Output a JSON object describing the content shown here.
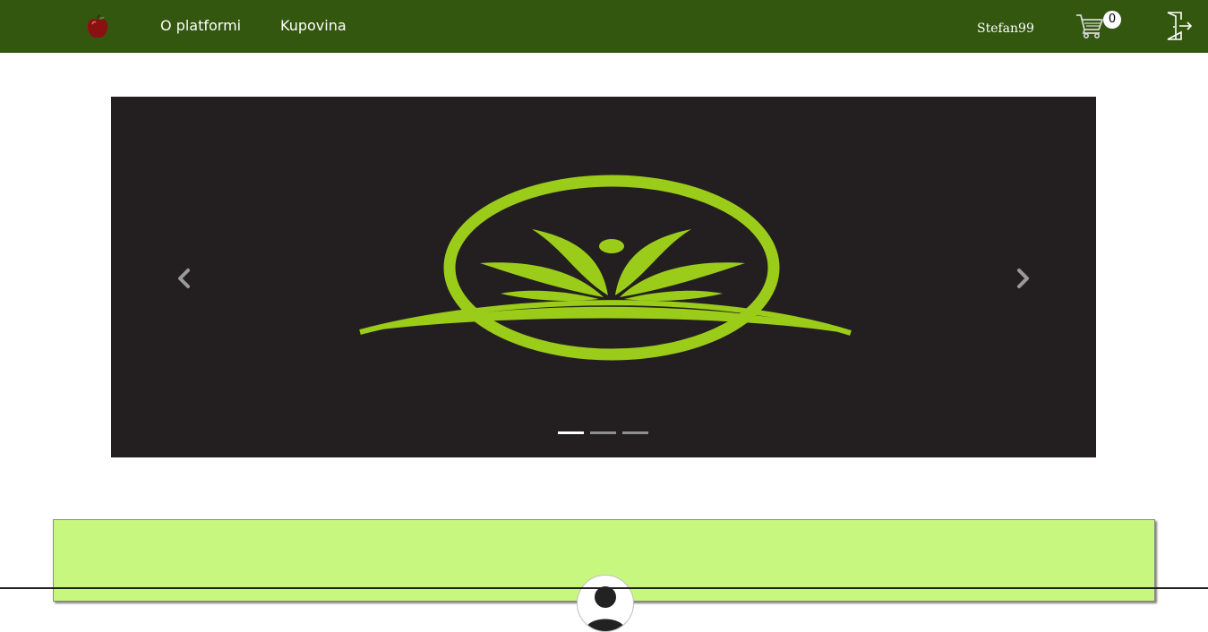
{
  "navbar": {
    "logo_icon": "apple-icon",
    "links": [
      "O platformi",
      "Kupovina"
    ],
    "username": "Stefan99",
    "cart_icon": "cart-icon",
    "cart_count": "0",
    "logout_icon": "logout-door-icon",
    "background": "#33570f"
  },
  "carousel": {
    "slide_icons": [
      "leaf-ring-logo"
    ],
    "prev_icon": "chevron-left-icon",
    "next_icon": "chevron-right-icon",
    "slide_count": 3,
    "active_index": 0,
    "background": "#231f20",
    "accent": "#9ccc1a"
  },
  "panel": {
    "background": "#c7f77f",
    "avatar_icon": "avatar-icon"
  }
}
